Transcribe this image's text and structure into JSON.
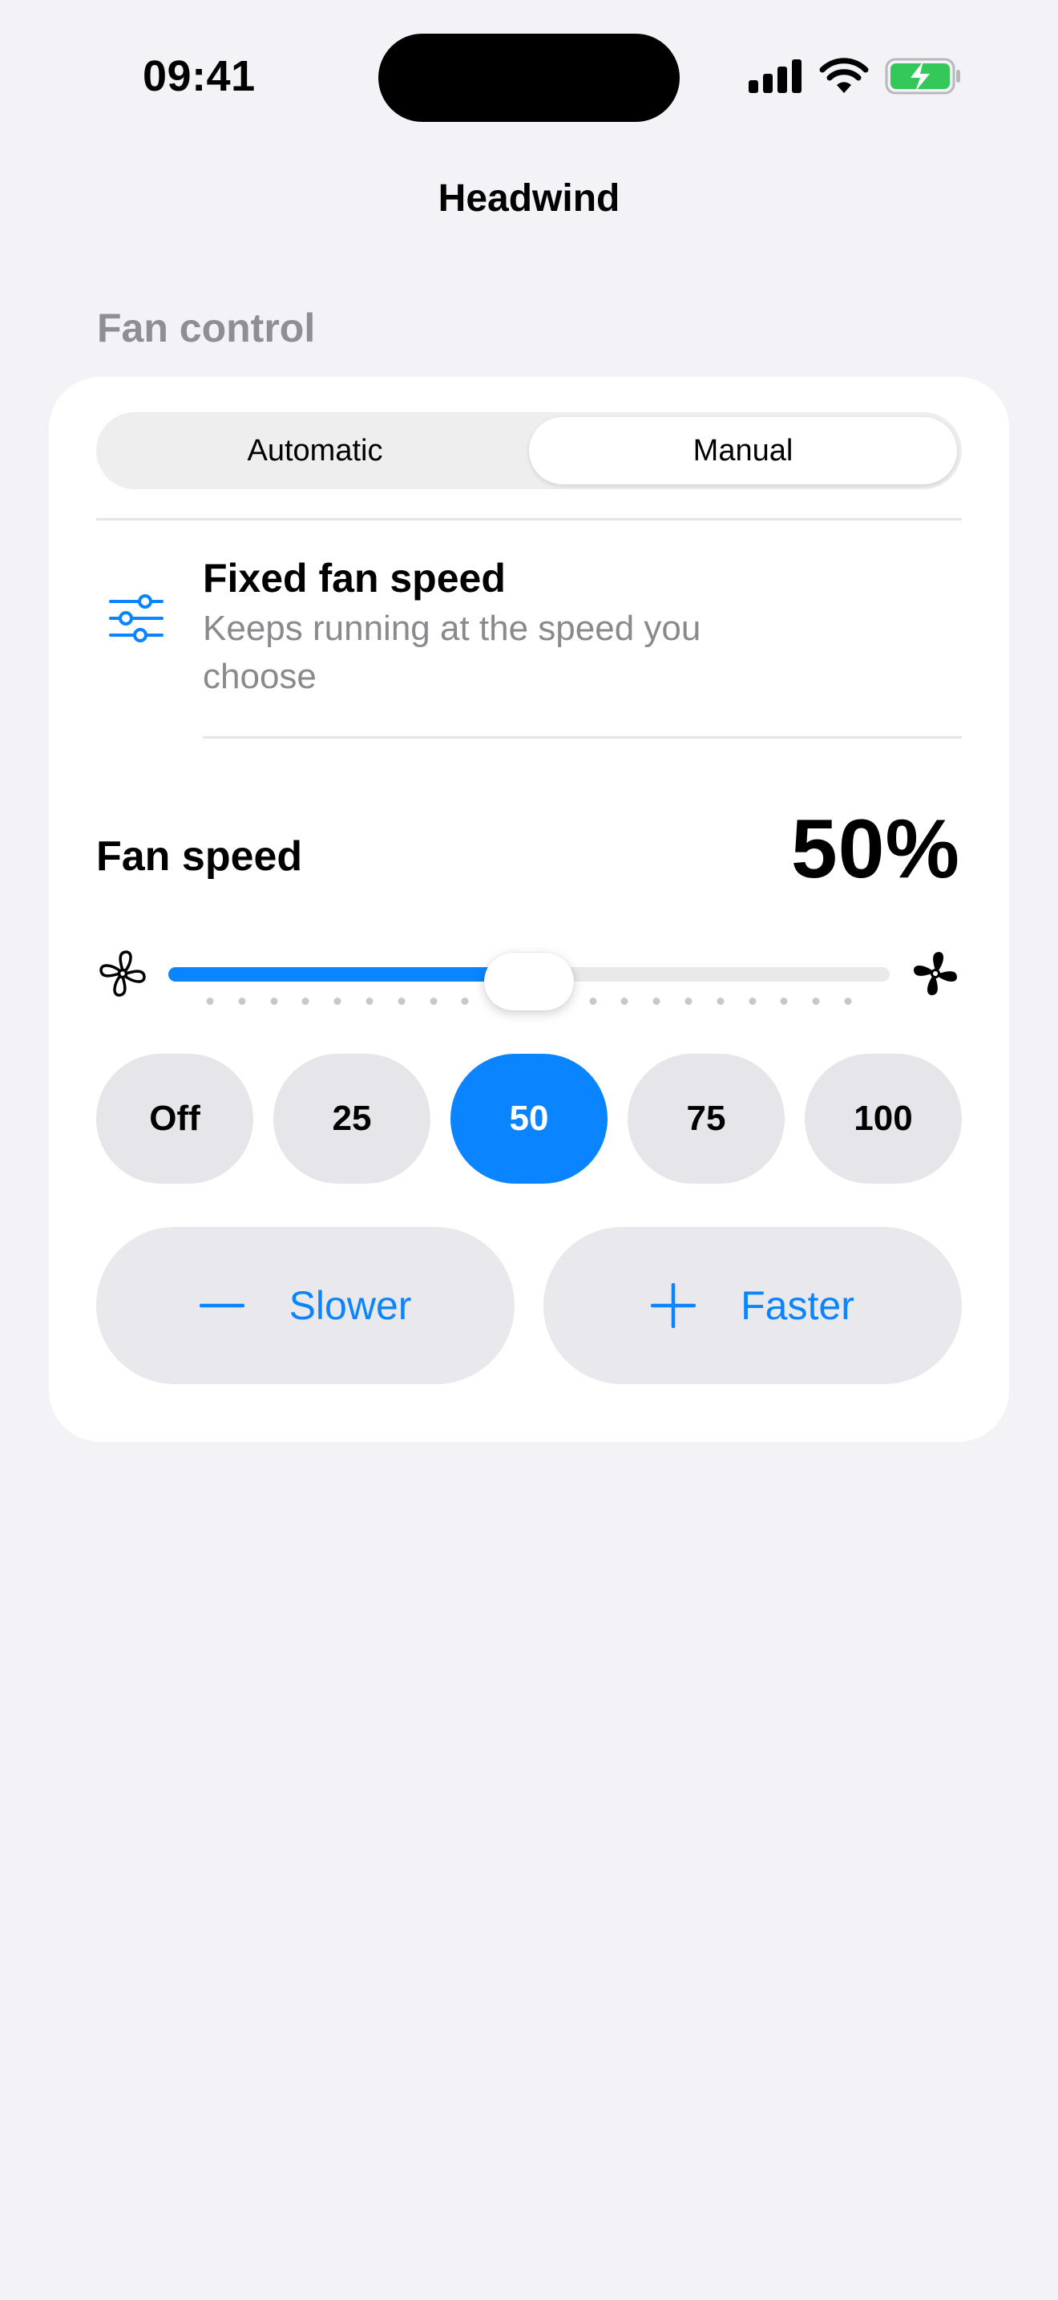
{
  "status_bar": {
    "time": "09:41"
  },
  "nav": {
    "title": "Headwind"
  },
  "section": {
    "header": "Fan control"
  },
  "mode_control": {
    "segments": [
      "Automatic",
      "Manual"
    ],
    "selected": "Manual"
  },
  "mode_description": {
    "title": "Fixed fan speed",
    "subtitle": "Keeps running at the speed you choose"
  },
  "fan_speed": {
    "label": "Fan speed",
    "value_text": "50%",
    "value": 50,
    "min": 0,
    "max": 100,
    "ticks": 21
  },
  "presets": {
    "items": [
      "Off",
      "25",
      "50",
      "75",
      "100"
    ],
    "selected": "50"
  },
  "steppers": {
    "slower_label": "Slower",
    "faster_label": "Faster"
  },
  "colors": {
    "accent": "#0a84ff",
    "battery": "#34c759",
    "background": "#f2f2f7"
  },
  "icons": {
    "signal": "cellular-signal-icon",
    "wifi": "wifi-icon",
    "battery": "battery-charging-icon",
    "mode": "sliders-icon",
    "fan_min": "fan-outline-icon",
    "fan_max": "fan-filled-icon",
    "minus": "minus-icon",
    "plus": "plus-icon"
  }
}
